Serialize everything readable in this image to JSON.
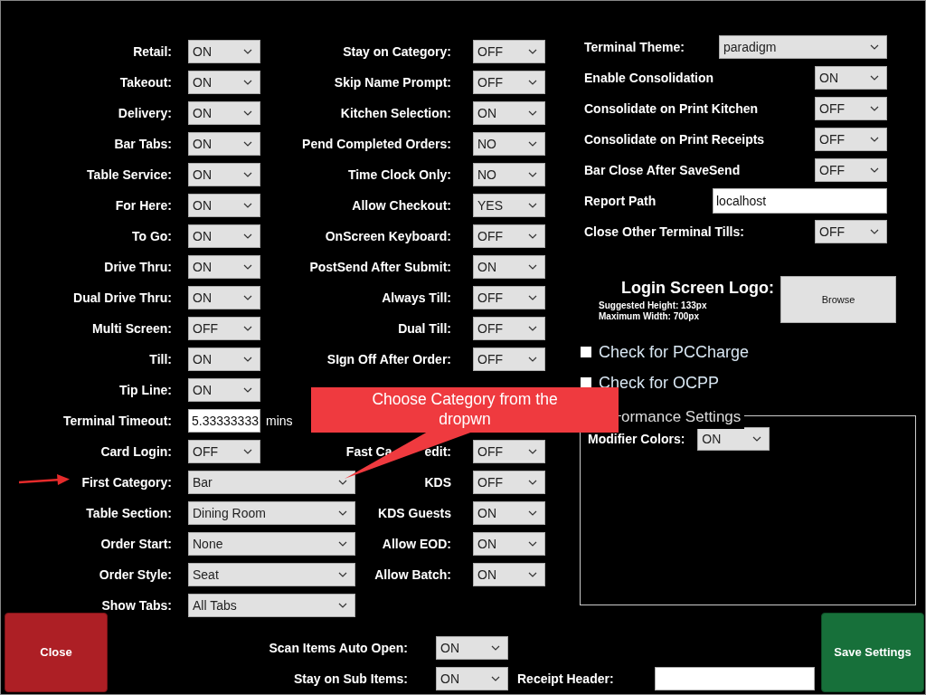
{
  "left": [
    {
      "label": "Retail:",
      "kind": "select",
      "value": "ON"
    },
    {
      "label": "Takeout:",
      "kind": "select",
      "value": "ON"
    },
    {
      "label": "Delivery:",
      "kind": "select",
      "value": "ON"
    },
    {
      "label": "Bar Tabs:",
      "kind": "select",
      "value": "ON"
    },
    {
      "label": "Table Service:",
      "kind": "select",
      "value": "ON"
    },
    {
      "label": "For Here:",
      "kind": "select",
      "value": "ON"
    },
    {
      "label": "To Go:",
      "kind": "select",
      "value": "ON"
    },
    {
      "label": "Drive Thru:",
      "kind": "select",
      "value": "ON"
    },
    {
      "label": "Dual Drive Thru:",
      "kind": "select",
      "value": "ON"
    },
    {
      "label": "Multi Screen:",
      "kind": "select",
      "value": "OFF"
    },
    {
      "label": "Till:",
      "kind": "select",
      "value": "ON"
    },
    {
      "label": "Tip Line:",
      "kind": "select",
      "value": "ON"
    },
    {
      "label": "Terminal Timeout:",
      "kind": "input",
      "value": "5.33333333",
      "suffix": "mins"
    },
    {
      "label": "Card Login:",
      "kind": "select",
      "value": "OFF"
    },
    {
      "label": "First Category:",
      "kind": "wide",
      "value": "Bar"
    },
    {
      "label": "Table Section:",
      "kind": "wide",
      "value": "Dining Room"
    },
    {
      "label": "Order Start:",
      "kind": "wide",
      "value": "None"
    },
    {
      "label": "Order Style:",
      "kind": "wide",
      "value": "Seat"
    },
    {
      "label": "Show Tabs:",
      "kind": "wide",
      "value": "All Tabs"
    }
  ],
  "middle": [
    {
      "label": "Stay on Category:",
      "value": "OFF"
    },
    {
      "label": "Skip Name Prompt:",
      "value": "OFF"
    },
    {
      "label": "Kitchen Selection:",
      "value": "ON"
    },
    {
      "label": "Pend Completed Orders:",
      "value": "NO"
    },
    {
      "label": "Time Clock Only:",
      "value": "NO"
    },
    {
      "label": "Allow Checkout:",
      "value": "YES"
    },
    {
      "label": "OnScreen Keyboard:",
      "value": "OFF"
    },
    {
      "label": "PostSend After Submit:",
      "value": "ON"
    },
    {
      "label": "Always Till:",
      "value": "OFF"
    },
    {
      "label": "Dual Till:",
      "value": "OFF"
    },
    {
      "label": "SIgn Off After Order:",
      "value": "OFF"
    },
    {
      "label": "Fast Ca",
      "label_tail": "edit:",
      "value": "OFF"
    },
    {
      "label": "KDS",
      "value": "OFF"
    },
    {
      "label": "KDS Guests",
      "value": "ON"
    },
    {
      "label": "Allow EOD:",
      "value": "ON"
    },
    {
      "label": "Allow Batch:",
      "value": "ON"
    }
  ],
  "right": [
    {
      "label": "Terminal Theme:",
      "kind": "wide",
      "value": "paradigm"
    },
    {
      "label": "Enable Consolidation",
      "kind": "select",
      "value": "ON"
    },
    {
      "label": "Consolidate on Print Kitchen",
      "kind": "select",
      "value": "OFF"
    },
    {
      "label": "Consolidate on Print Receipts",
      "kind": "select",
      "value": "OFF"
    },
    {
      "label": "Bar Close After SaveSend",
      "kind": "select",
      "value": "OFF"
    },
    {
      "label": "Report Path",
      "kind": "input",
      "value": "localhost"
    },
    {
      "label": "Close Other Terminal Tills:",
      "kind": "select",
      "value": "OFF"
    }
  ],
  "logo": {
    "label": "Login Screen Logo:",
    "hint_lines": [
      "Suggested Height: 133px",
      "Maximum Width: 700px"
    ],
    "button": "Browse"
  },
  "checkboxes": [
    {
      "label": "Check for PCCharge",
      "checked": false
    },
    {
      "label": "Check for OCPP",
      "checked": false
    }
  ],
  "performance": {
    "legend": "ormance Settings",
    "rows": [
      {
        "label": "Modifier Colors:",
        "value": "ON"
      }
    ]
  },
  "bottom": {
    "close": "Close",
    "save": "Save Settings",
    "rows": [
      {
        "label": "Scan Items Auto Open:",
        "value": "ON"
      },
      {
        "label": "Stay on Sub Items:",
        "value": "ON"
      }
    ],
    "receipt_header": {
      "label": "Receipt Header:"
    }
  },
  "callout": {
    "text": "Choose Category from the dropwn"
  }
}
